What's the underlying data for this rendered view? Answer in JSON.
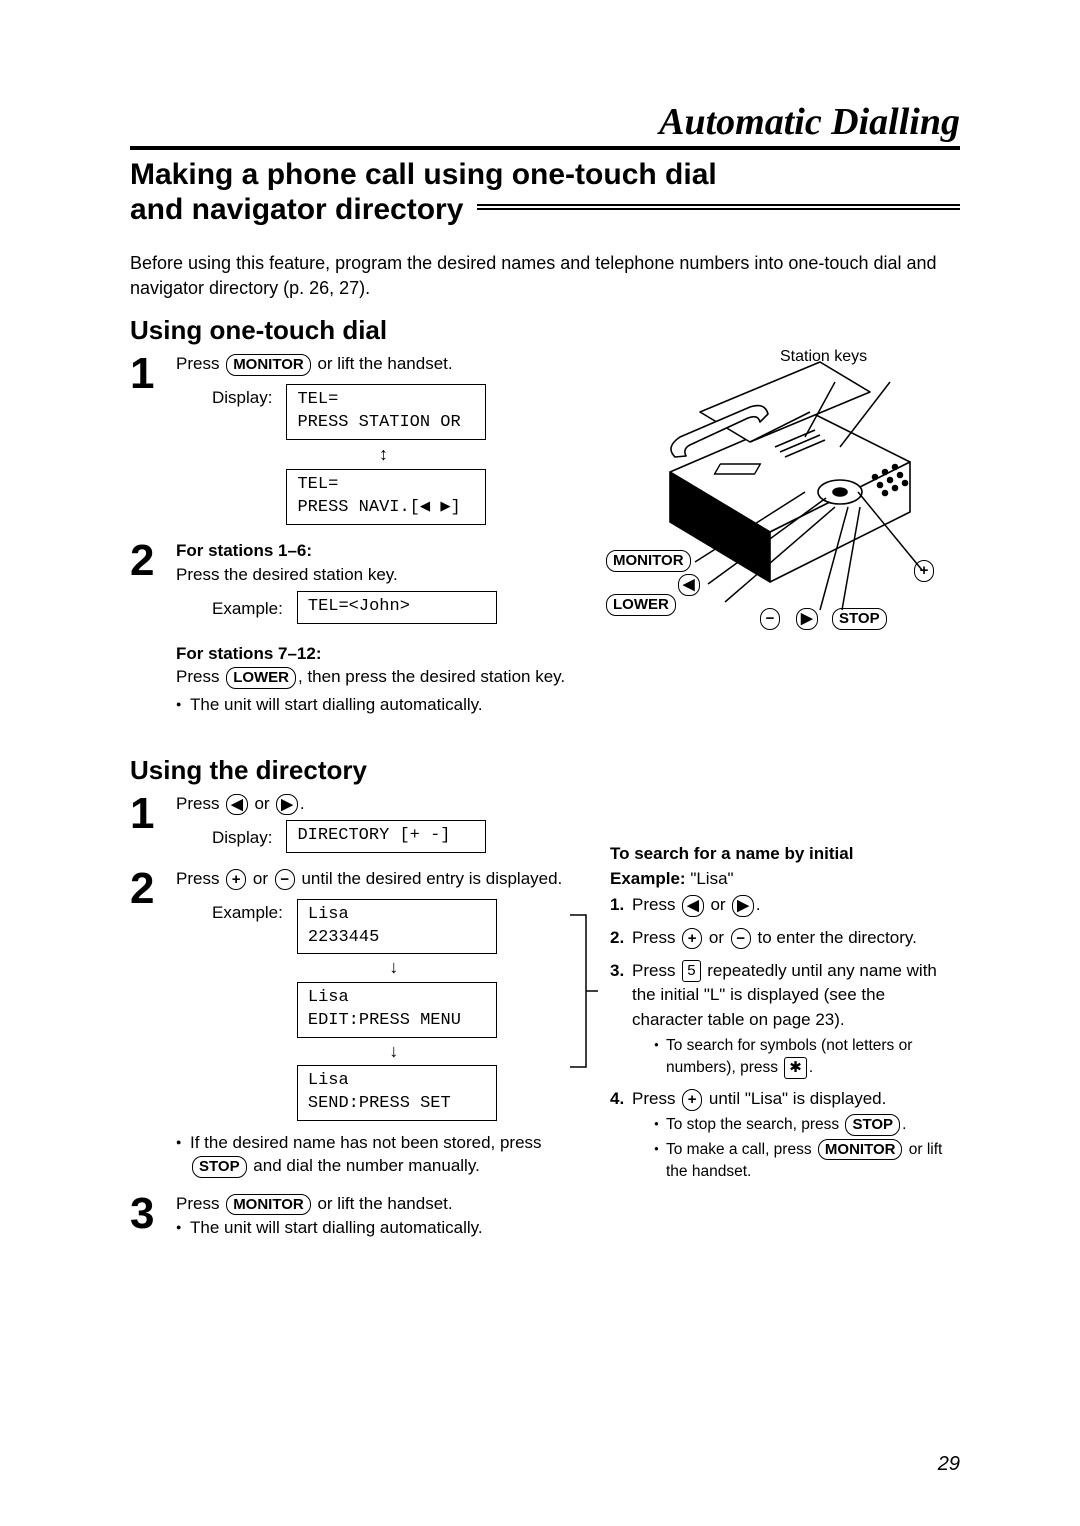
{
  "page": {
    "title": "Automatic Dialling",
    "section_title_l1": "Making a phone call using one-touch dial",
    "section_title_l2": "and navigator directory",
    "intro": "Before using this feature, program the desired names and telephone numbers into one-touch dial and navigator directory (p. 26, 27).",
    "page_number": "29"
  },
  "one_touch": {
    "heading": "Using one-touch dial",
    "s1_a": "Press ",
    "s1_b": " or lift the handset.",
    "display_label": "Display:",
    "lcd1_l1": "TEL=",
    "lcd1_l2": "PRESS STATION OR",
    "lcd2_l1": "TEL=",
    "lcd2_l2": "PRESS NAVI.[◀ ▶]",
    "s2_h1": "For stations 1–6:",
    "s2_t1": "Press the desired station key.",
    "example_label": "Example:",
    "lcd3": "TEL=<John>",
    "s2_h2": "For stations 7–12:",
    "s2_t2a": "Press ",
    "s2_t2b": ", then press the desired station key.",
    "s2_b1": "The unit will start dialling automatically."
  },
  "directory": {
    "heading": "Using the directory",
    "s1_a": "Press ",
    "s1_b": " or ",
    "s1_c": ".",
    "display_label": "Display:",
    "lcd1": "DIRECTORY   [+ -]",
    "s2_a": "Press ",
    "s2_b": " or ",
    "s2_c": " until the desired entry is displayed.",
    "example_label": "Example:",
    "lcdA_l1": "Lisa",
    "lcdA_l2": "2233445",
    "lcdB_l1": "Lisa",
    "lcdB_l2": "EDIT:PRESS MENU",
    "lcdC_l1": "Lisa",
    "lcdC_l2": "SEND:PRESS SET",
    "s2_bul_a": "If the desired name has not been stored, press ",
    "s2_bul_b": " and dial the number manually.",
    "s3_a": "Press ",
    "s3_b": " or lift the handset.",
    "s3_bul": "The unit will start dialling automatically."
  },
  "keys": {
    "monitor": "MONITOR",
    "lower": "LOWER",
    "stop": "STOP",
    "left": "◀",
    "right": "▶",
    "plus": "+",
    "minus": "−",
    "five": "5",
    "star": "✱"
  },
  "illus": {
    "station_keys": "Station keys",
    "monitor": "MONITOR",
    "lower": "LOWER",
    "stop": "STOP",
    "left": "◀",
    "right": "▶",
    "plus": "+",
    "minus": "−"
  },
  "search": {
    "heading": "To search for a name by initial",
    "ex_label": "Example:",
    "ex_val": " \"Lisa\"",
    "l1_a": "Press ",
    "l1_b": " or ",
    "l1_c": ".",
    "l2_a": "Press ",
    "l2_b": " or ",
    "l2_c": " to enter the directory.",
    "l3_a": "Press ",
    "l3_b": " repeatedly until any name with the initial \"L\" is displayed (see the character table on page 23).",
    "l3_sub_a": "To search for symbols (not letters or numbers), press ",
    "l3_sub_b": ".",
    "l4_a": "Press ",
    "l4_b": " until \"Lisa\" is displayed.",
    "l4_sub1_a": "To stop the search, press ",
    "l4_sub1_b": ".",
    "l4_sub2_a": "To make a call, press ",
    "l4_sub2_b": " or lift the handset."
  }
}
